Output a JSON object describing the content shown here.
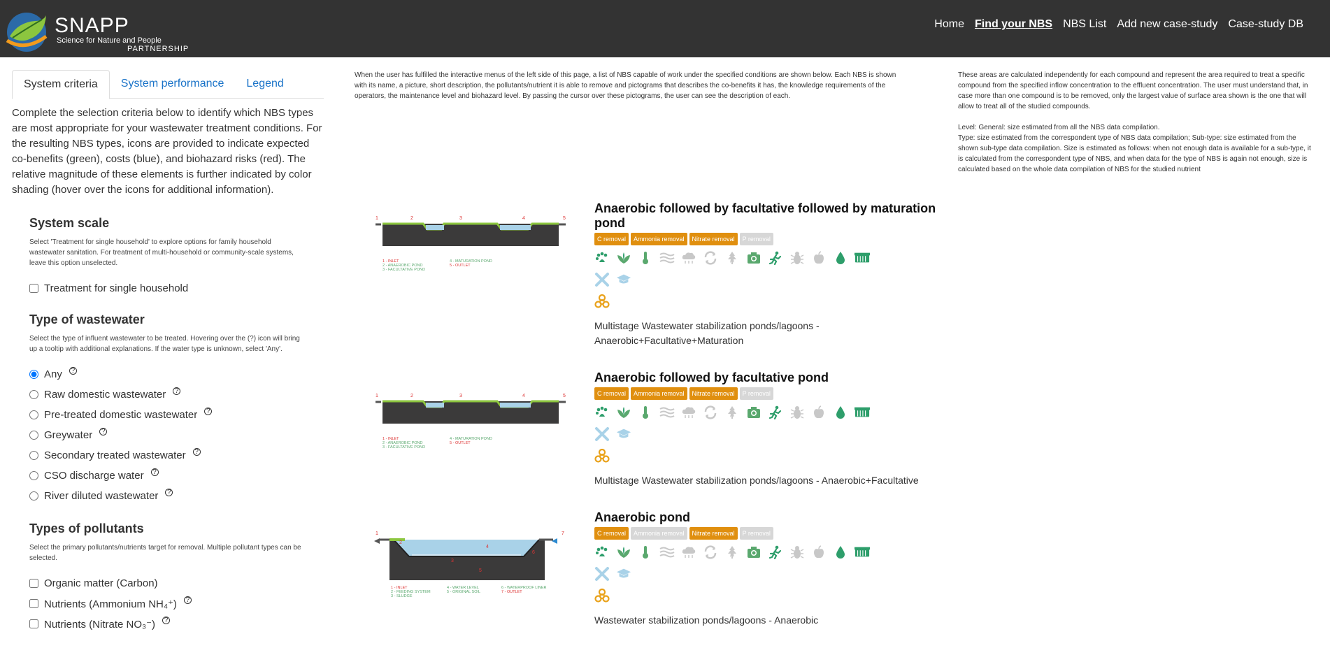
{
  "brand": {
    "title": "SNAPP",
    "subtitle_line1": "Science for Nature and People",
    "subtitle_line2": "PARTNERSHIP"
  },
  "nav": {
    "items": [
      {
        "label": "Home"
      },
      {
        "label": "Find your NBS",
        "active": true
      },
      {
        "label": "NBS List"
      },
      {
        "label": "Add new case-study"
      },
      {
        "label": "Case-study DB"
      }
    ]
  },
  "tabs": [
    {
      "label": "System criteria",
      "active": true
    },
    {
      "label": "System performance"
    },
    {
      "label": "Legend"
    }
  ],
  "intro": "Complete the selection criteria below to identify which NBS types are most appropriate for your wastewater treatment conditions. For the resulting NBS types, icons are provided to indicate expected co-benefits (green), costs (blue), and biohazard risks (red). The relative magnitude of these elements is further indicated by color shading (hover over the icons for additional information).",
  "scale": {
    "heading": "System scale",
    "desc": "Select 'Treatment for single household' to explore options for family household wastewater sanitation. For treatment of multi-household or community-scale systems, leave this option unselected.",
    "option": "Treatment for single household"
  },
  "wastewater": {
    "heading": "Type of wastewater",
    "desc": "Select the type of influent wastewater to be treated. Hovering over the (?) icon will bring up a tooltip with additional explanations. If the water type is unknown, select 'Any'.",
    "options": [
      {
        "label": "Any",
        "checked": true
      },
      {
        "label": "Raw domestic wastewater"
      },
      {
        "label": "Pre-treated domestic wastewater"
      },
      {
        "label": "Greywater"
      },
      {
        "label": "Secondary treated wastewater"
      },
      {
        "label": "CSO discharge water"
      },
      {
        "label": "River diluted wastewater"
      }
    ],
    "help_glyph": "?"
  },
  "pollutants": {
    "heading": "Types of pollutants",
    "desc": "Select the primary pollutants/nutrients target for removal. Multiple pollutant types can be selected.",
    "options": [
      {
        "label": "Organic matter (Carbon)"
      },
      {
        "label": "Nutrients (Ammonium NH₄⁺)"
      },
      {
        "label": "Nutrients (Nitrate NO₃⁻)"
      }
    ]
  },
  "mid_text": "When the user has fulfilled the interactive menus of the left side of this page, a list of NBS capable of work under the specified conditions are shown below. Each NBS is shown with its name, a picture, short description, the pollutants/nutrient it is able to remove and pictograms that describes the co-benefits it has, the knowledge requirements of the operators, the maintenance level and biohazard level. By passing the cursor over these pictograms, the user can see the description of each.",
  "right_text": {
    "p1": "These areas are calculated independently for each compound and represent the area required to treat a specific compound from the specified inflow concentration to the effluent concentration. The user must understand that, in case more than one compound is to be removed, only the largest value of surface area shown is the one that will allow to treat all of the studied compounds.",
    "p2": "Level: General: size estimated from all the NBS data compilation.",
    "p3": "Type: size estimated from the correspondent type of NBS data compilation; Sub-type: size estimated from the shown sub-type data compilation. Size is estimated as follows: when not enough data is available for a sub-type, it is calculated from the correspondent type of NBS, and when data for the type of NBS is again not enough, size is calculated based on the whole data compilation of NBS for the studied nutrient"
  },
  "badge_labels": [
    "C removal",
    "Ammonia removal",
    "Nitrate removal",
    "P removal"
  ],
  "diagram_labels": {
    "pond_left": "1 - INLET\n2 - ANAEROBIC POND\n3 - FACULTATIVE POND",
    "pond_right": "4 - MATURATION POND\n5 - OUTLET",
    "anaer_col1": "1 - INLET\n2 - FEEDING SYSTEM\n3 - SLUDGE",
    "anaer_col2": "4 - WATER LEVEL\n5 - ORIGINAL SOIL",
    "anaer_col3": "6 - WATERPROOF LINER\n7 - OUTLET"
  },
  "nbs": [
    {
      "title": "Anaerobic followed by facultative followed by maturation pond",
      "badges": [
        true,
        true,
        true,
        false
      ],
      "description": "Multistage Wastewater stabilization ponds/lagoons - Anaerobic+Facultative+Maturation"
    },
    {
      "title": "Anaerobic followed by facultative pond",
      "badges": [
        true,
        true,
        true,
        false
      ],
      "description": "Multistage Wastewater stabilization ponds/lagoons - Anaerobic+Facultative"
    },
    {
      "title": "Anaerobic pond",
      "badges": [
        true,
        false,
        true,
        false
      ],
      "description": "Wastewater stabilization ponds/lagoons - Anaerobic"
    }
  ],
  "colors": {
    "navbar": "#333333",
    "link": "#1a73c8",
    "badge_on": "#e08f0f",
    "badge_off": "#d7d7d7",
    "benefit_green": "#2e9e6b",
    "inactive_grey": "#c8c8c8",
    "cost_blue": "#a9d2e8",
    "hazard_orange": "#e9a21b"
  }
}
